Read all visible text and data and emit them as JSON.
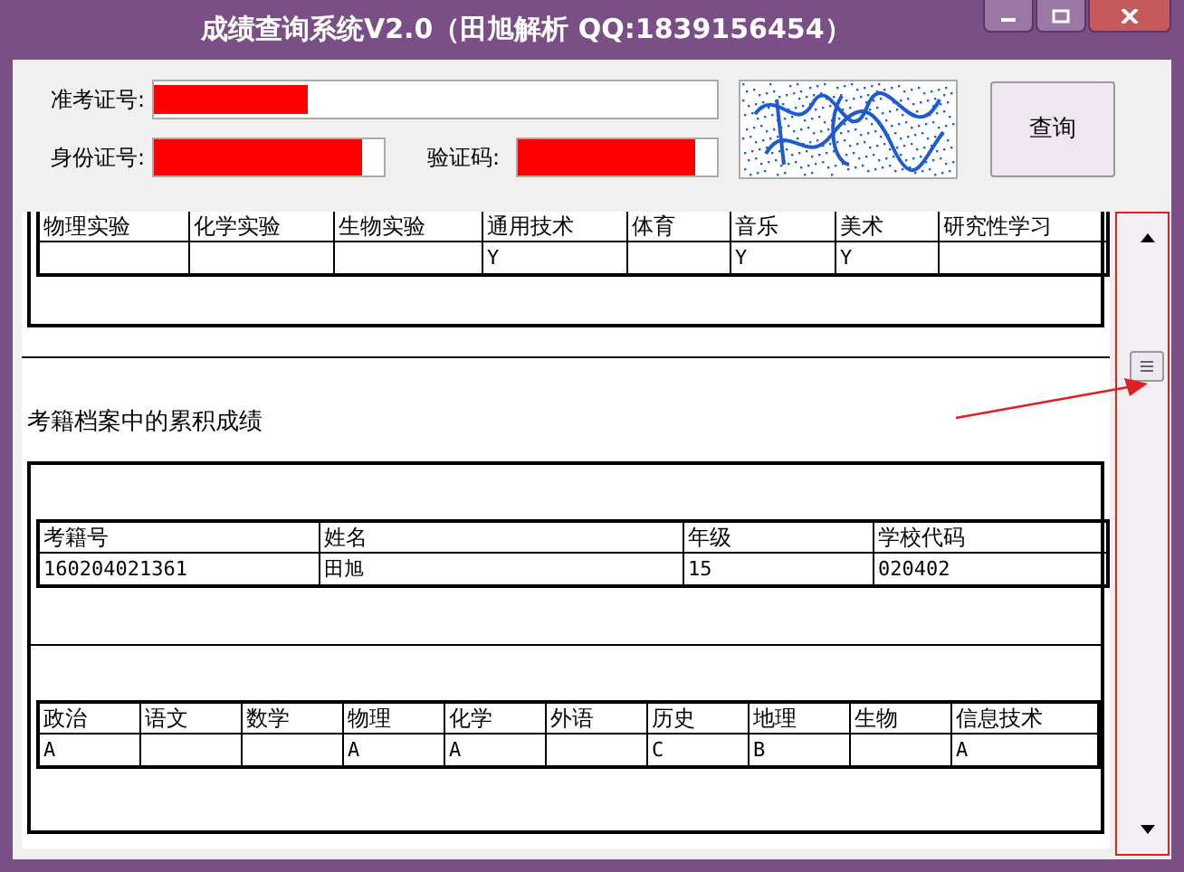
{
  "window": {
    "title": "成绩查询系统V2.0（田旭解析 QQ:1839156454）"
  },
  "form": {
    "fields": [
      {
        "label": "准考证号:",
        "redacted": true
      },
      {
        "label": "身份证号:",
        "redacted": true
      },
      {
        "label": "验证码:",
        "redacted": true
      }
    ],
    "query_button": "查询"
  },
  "results": {
    "sections": [
      {
        "tables": [
          {
            "columns": [
              "物理实验",
              "化学实验",
              "生物实验",
              "通用技术",
              "体育",
              "音乐",
              "美术",
              "研究性学习"
            ],
            "rows": [
              [
                null,
                null,
                null,
                "Y",
                null,
                "Y",
                "Y",
                null
              ]
            ]
          }
        ]
      },
      {
        "heading": "考籍档案中的累积成绩",
        "tables": [
          {
            "columns": [
              "考籍号",
              "姓名",
              "年级",
              "学校代码"
            ],
            "rows": [
              [
                "160204021361",
                "田旭",
                "15",
                "020402"
              ]
            ]
          },
          {
            "columns": [
              "政治",
              "语文",
              "数学",
              "物理",
              "化学",
              "外语",
              "历史",
              "地理",
              "生物",
              "信息技术"
            ],
            "rows": [
              [
                "A",
                null,
                null,
                "A",
                "A",
                null,
                "C",
                "B",
                null,
                "A"
              ]
            ]
          }
        ]
      }
    ]
  }
}
